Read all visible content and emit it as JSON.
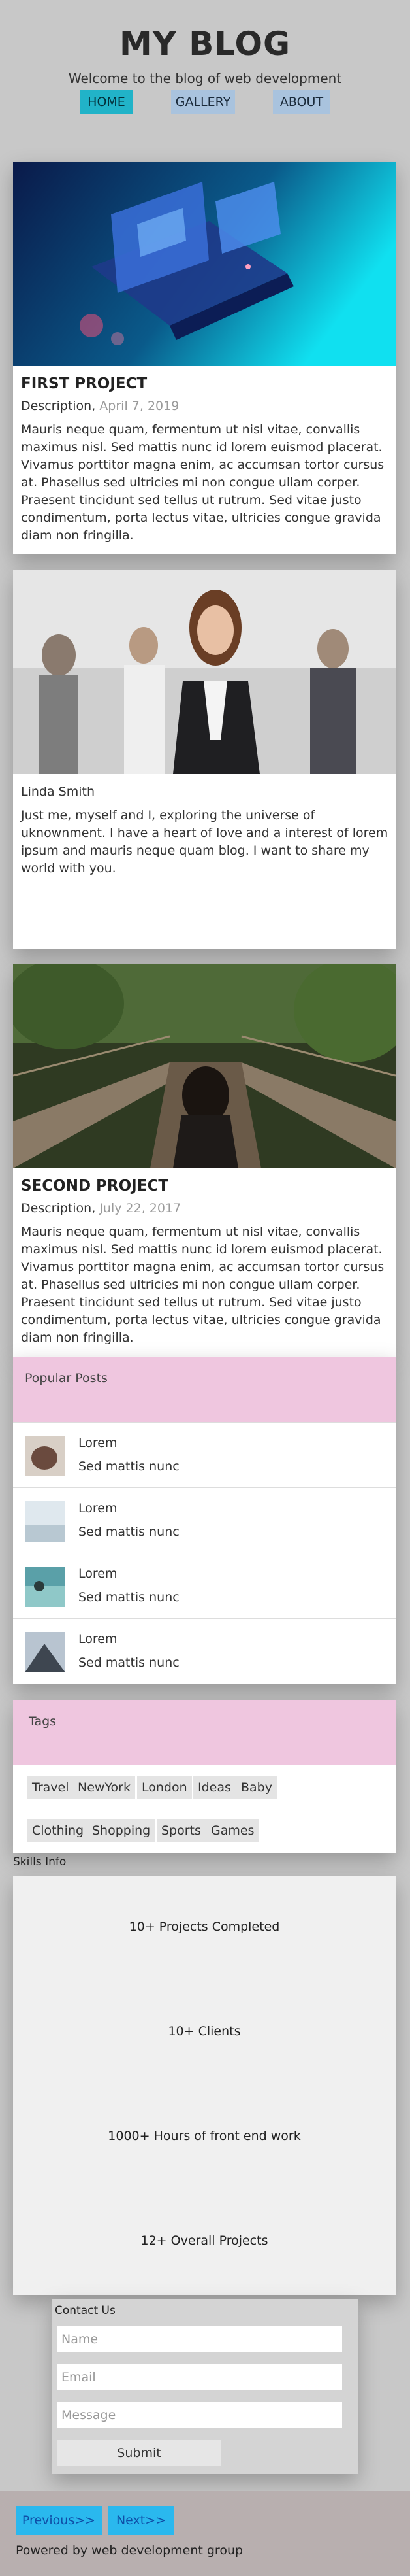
{
  "header": {
    "title": "MY BLOG",
    "subtitle": "Welcome to the blog of web development",
    "nav": [
      {
        "label": "HOME"
      },
      {
        "label": "GALLERY"
      },
      {
        "label": "ABOUT"
      }
    ]
  },
  "posts": [
    {
      "title": "FIRST PROJECT",
      "desc_label": "Description,",
      "date": "April 7, 2019",
      "body": "Mauris neque quam, fermentum ut nisl vitae, convallis maximus nisl. Sed mattis nunc id lorem euismod placerat. Vivamus porttitor magna enim, ac accumsan tortor cursus at. Phasellus sed ultricies mi non congue ullam corper. Praesent tincidunt sed tellus ut rutrum. Sed vitae justo condimentum, porta lectus vitae, ultricies congue gravida diam non fringilla."
    },
    {
      "title": "SECOND PROJECT",
      "desc_label": "Description,",
      "date": "July 22, 2017",
      "body": "Mauris neque quam, fermentum ut nisl vitae, convallis maximus nisl. Sed mattis nunc id lorem euismod placerat. Vivamus porttitor magna enim, ac accumsan tortor cursus at. Phasellus sed ultricies mi non congue ullam corper. Praesent tincidunt sed tellus ut rutrum. Sed vitae justo condimentum, porta lectus vitae, ultricies congue gravida diam non fringilla."
    }
  ],
  "about": {
    "name": "Linda Smith",
    "bio": "Just me, myself and I, exploring the universe of uknownment. I have a heart of love and a interest of lorem ipsum and mauris neque quam blog. I want to share my world with you."
  },
  "popular": {
    "heading": "Popular Posts",
    "items": [
      {
        "title": "Lorem",
        "sub": "Sed mattis nunc"
      },
      {
        "title": "Lorem",
        "sub": "Sed mattis nunc"
      },
      {
        "title": "Lorem",
        "sub": "Sed mattis nunc"
      },
      {
        "title": "Lorem",
        "sub": "Sed mattis nunc"
      }
    ]
  },
  "tags": {
    "heading": "Tags",
    "items": [
      "Travel",
      "NewYork",
      "London",
      "Ideas",
      "Baby",
      "Clothing",
      "Shopping",
      "Sports",
      "Games"
    ]
  },
  "skills": {
    "heading": "Skills Info",
    "items": [
      "10+ Projects Completed",
      "10+ Clients",
      "1000+ Hours of front end work",
      "12+ Overall Projects"
    ]
  },
  "contact": {
    "heading": "Contact Us",
    "name_placeholder": "Name",
    "email_placeholder": "Email",
    "message_placeholder": "Message",
    "submit": "Submit"
  },
  "footer": {
    "prev": "Previous>>",
    "next": "Next>>",
    "credit": "Powered by web development group"
  }
}
